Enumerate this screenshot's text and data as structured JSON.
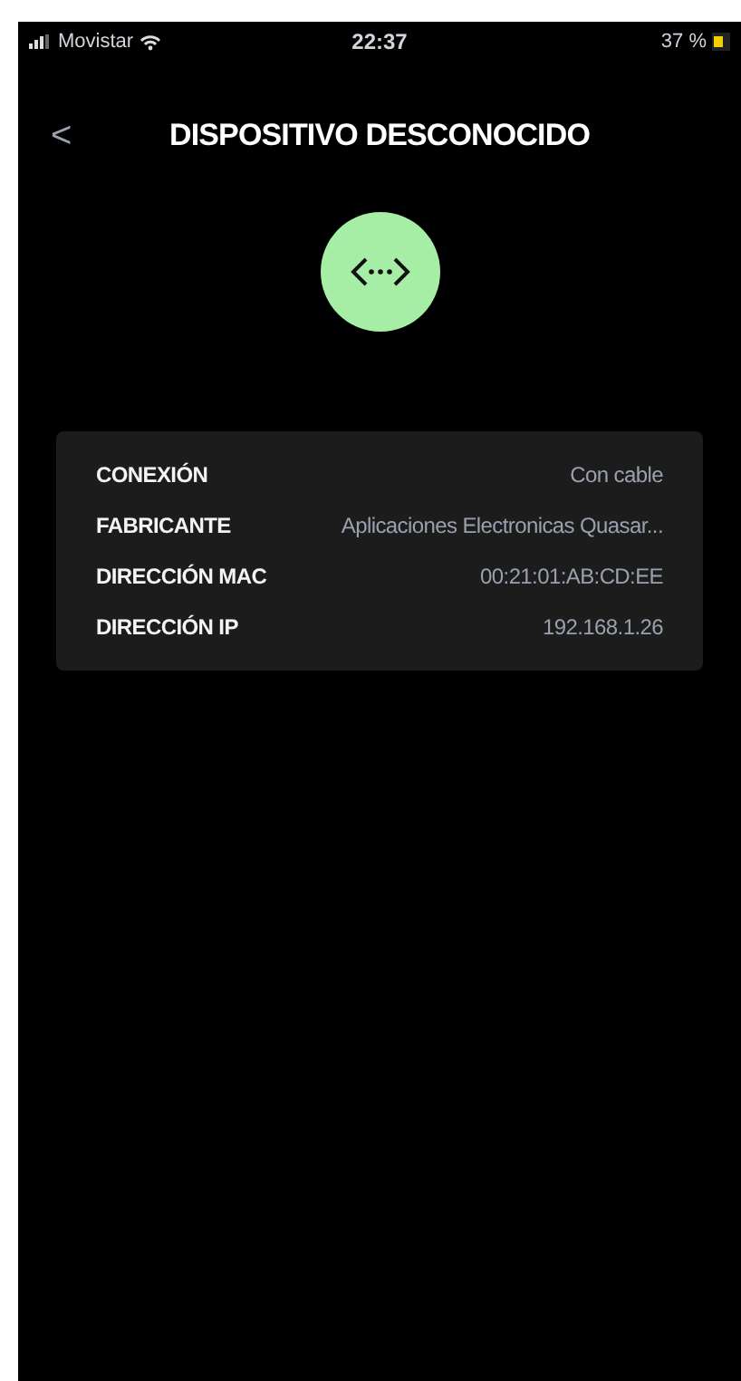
{
  "status_bar": {
    "carrier": "Movistar",
    "time": "22:37",
    "battery": "37 %"
  },
  "header": {
    "back": "<",
    "title": "DISPOSITIVO DESCONOCIDO"
  },
  "details": [
    {
      "label": "CONEXIÓN",
      "value": "Con cable"
    },
    {
      "label": "FABRICANTE",
      "value": "Aplicaciones Electronicas Quasar..."
    },
    {
      "label": "DIRECCIÓN MAC",
      "value": "00:21:01:AB:CD:EE"
    },
    {
      "label": "DIRECCIÓN IP",
      "value": "192.168.1.26"
    }
  ]
}
